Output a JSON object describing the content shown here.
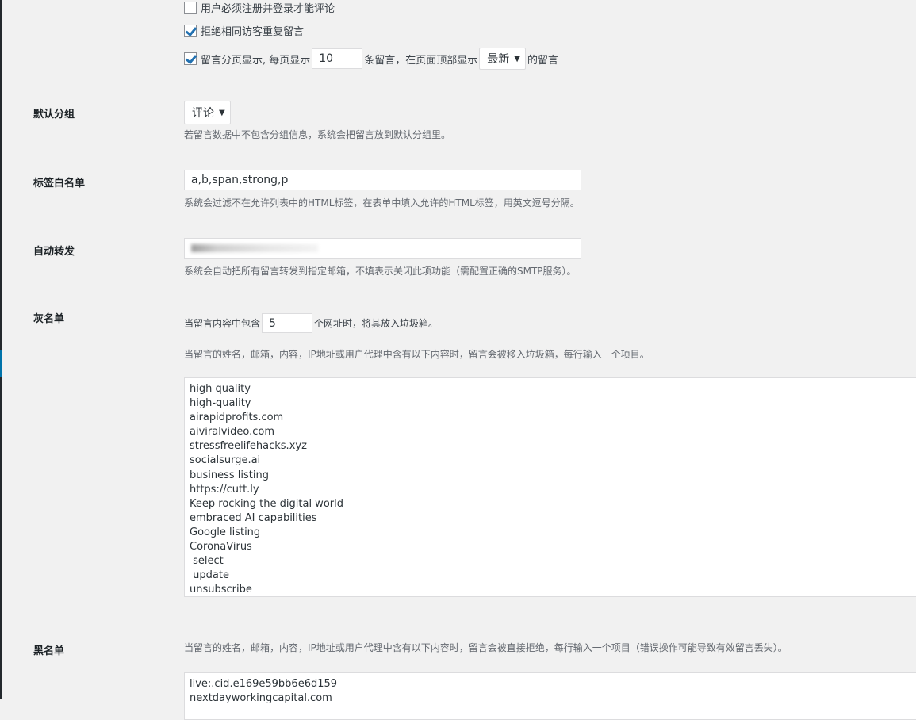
{
  "discussion": {
    "require_login_label": "用户必须注册并登录才能评论",
    "require_login_checked": false,
    "reject_duplicate_label": "拒绝相同访客重复留言",
    "reject_duplicate_checked": true,
    "paginate_label": "留言分页显示, 每页显示",
    "paginate_checked": true,
    "per_page_value": "10",
    "paginate_mid": "条留言，在页面顶部显示",
    "order_value": "最新",
    "paginate_end": "的留言"
  },
  "default_group": {
    "label": "默认分组",
    "value": "评论",
    "desc": "若留言数据中不包含分组信息，系统会把留言放到默认分组里。"
  },
  "tag_whitelist": {
    "label": "标签白名单",
    "value": "a,b,span,strong,p",
    "desc": "系统会过滤不在允许列表中的HTML标签，在表单中填入允许的HTML标签，用英文逗号分隔。"
  },
  "auto_forward": {
    "label": "自动转发",
    "desc": "系统会自动把所有留言转发到指定邮箱，不填表示关闭此项功能（需配置正确的SMTP服务）。"
  },
  "greylist": {
    "label": "灰名单",
    "links_prefix": "当留言内容中包含",
    "links_value": "5",
    "links_suffix": "个网址时，将其放入垃圾箱。",
    "desc": "当留言的姓名，邮箱，内容，IP地址或用户代理中含有以下内容时，留言会被移入垃圾箱，每行输入一个项目。",
    "items": [
      "high quality",
      "high-quality",
      "airapidprofits.com",
      "aiviralvideo.com",
      "stressfreelifehacks.xyz",
      "socialsurge.ai",
      "business listing",
      "https://cutt.ly",
      "Keep rocking the digital world",
      "embraced AI capabilities",
      "Google listing",
      "CoronaVirus",
      " select",
      " update",
      "unsubscribe"
    ]
  },
  "blacklist": {
    "label": "黑名单",
    "desc": "当留言的姓名，邮箱，内容，IP地址或用户代理中含有以下内容时，留言会被直接拒绝，每行输入一个项目（错误操作可能导致有效留言丢失）。",
    "items": [
      "live:.cid.e169e59bb6e6d159",
      "nextdayworkingcapital.com"
    ]
  }
}
